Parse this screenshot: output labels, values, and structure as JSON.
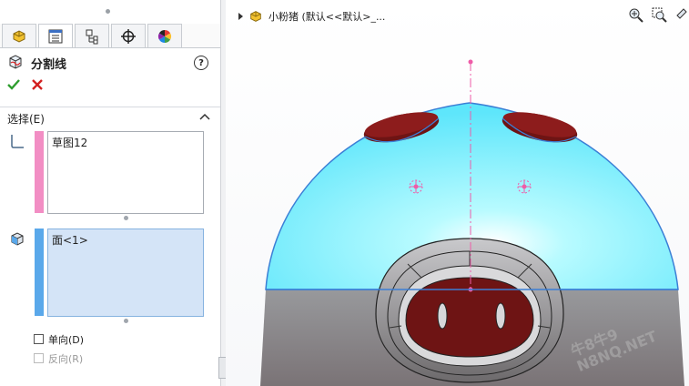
{
  "feature_manager": {
    "tabs": [
      {
        "name": "feature-manager-tab",
        "icon": "feature-tree-icon"
      },
      {
        "name": "property-manager-tab",
        "icon": "property-list-icon"
      },
      {
        "name": "configuration-manager-tab",
        "icon": "configuration-icon"
      },
      {
        "name": "dimxpert-tab",
        "icon": "crosshair-icon"
      },
      {
        "name": "display-manager-tab",
        "icon": "color-wheel-icon"
      }
    ]
  },
  "property_manager": {
    "title": "分割线",
    "help_label": "?",
    "section": {
      "title": "选择(E)",
      "sketch_box": {
        "items": [
          "草图12"
        ],
        "color": "#f28ec4"
      },
      "face_box": {
        "items": [
          "面<1>"
        ],
        "color": "#5aa8ea"
      },
      "single_direction_label": "单向(D)",
      "reverse_direction_label": "反向(R)"
    }
  },
  "viewport": {
    "tree_label": "小粉猪 (默认<<默认>_...",
    "model": {
      "upper_color": "#7ff0ff",
      "lower_color": "#8e8a8c",
      "nose_color": "#6e1414"
    }
  },
  "watermark": {
    "line1": "牛8牛9",
    "line2": "N8NQ.NET"
  }
}
